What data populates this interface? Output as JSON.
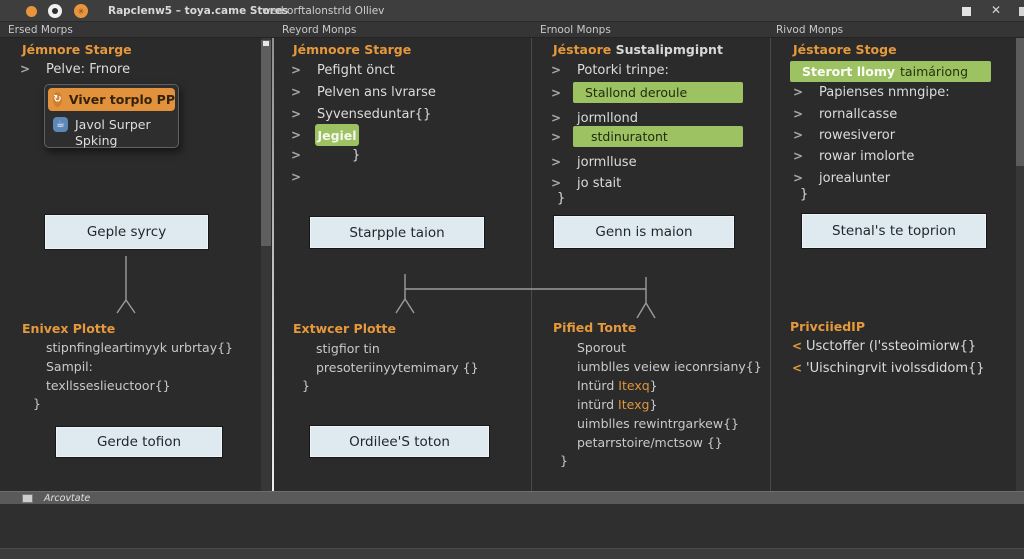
{
  "titlebar": {
    "title": "Rapclenw5 – toya.came Stores",
    "subtitle": "wed orftalonstrld Olliev"
  },
  "pane_headers": {
    "h1": "Ersed Morps",
    "h2": "Reyord Monps",
    "h3": "Ernool Monps",
    "h4": "Rivod Monps"
  },
  "icons": {
    "chevron_right": ">",
    "chevron_left": "<",
    "close": "✕",
    "refresh": "↻",
    "java": "☕"
  },
  "col1": {
    "title": "Jémnore Starge",
    "row1": "Pelve: Frnore",
    "popup": {
      "item1": "Viver torplo PP",
      "item2": "Javol Surper",
      "item3": "Spking"
    },
    "button_top": "Geple syrcy",
    "section_title": "Enivex Plotte",
    "code1": "stipnfingleartimyyk urbrtay{}",
    "code2": "Sampil:",
    "code3": "texllsseslieuctoor{}",
    "code4": "}",
    "button_bottom": "Gerde tofion"
  },
  "col2": {
    "title": "Jémnoore Starge",
    "row1": "Pefight önct",
    "row2": "Pelven ans lvrarse",
    "row3": "Syvenseduntar{}",
    "chip": "Jegiel",
    "row5": "}",
    "button_top": "Starpple taion",
    "section_title": "Extwcer Plotte",
    "code1": "stigfior tin",
    "code2": "presoteriinyytemimary {}",
    "code3": "}",
    "button_bottom": "Ordilee'S toton"
  },
  "col3": {
    "title_accent": "Jéstaore",
    "title_rest": " Sustalipmgipnt",
    "row1": "Potorki trinpe:",
    "hl1": "Stallond deroule",
    "row2": "jormllond",
    "hl2": "stdinuratont",
    "row3": "jormlluse",
    "row4": "jo stait",
    "brace": "}",
    "button_top": "Genn is maion",
    "section_title": "Pified Tonte",
    "code1": "Sporout",
    "code2": "iumblles veiew ieconrsiany{}",
    "code3_pre": "Intürd ",
    "code3_tok": "Itexq",
    "code3_post": "}",
    "code4_pre": "intürd ",
    "code4_tok": "Itexg",
    "code4_post": "}",
    "code5": "uimblles rewintrgarkew{}",
    "code6": "petarrstoire/mctsow {}",
    "code7": "}"
  },
  "col4": {
    "title": "Jéstaore Stoge",
    "banner_bold": "Sterort llomy",
    "banner_rest": "taimáriong",
    "row1": "Papienses nmngipe:",
    "row2": "rornallcasse",
    "row3": "rowesiveror",
    "row4": "rowar imolorte",
    "row5": "jorealunter",
    "brace": "}",
    "button_top": "Stenal's te toprion",
    "section_title": "PrivciiedIP",
    "item1": "Usctoffer (l'ssteoimiorw{}",
    "item2": "'Uischingrvit ivolssdidom{}"
  },
  "statusbar": {
    "label": "Arcovtate"
  },
  "colors": {
    "accent_orange": "#e6993b",
    "highlight_green": "#9cc261",
    "selection_orange": "#e2913c",
    "button_bg": "#dfe9f0",
    "canvas_bg": "#2b2b2b"
  }
}
